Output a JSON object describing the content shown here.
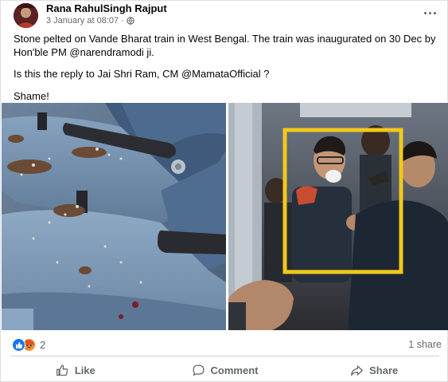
{
  "post": {
    "author": "Rana RahulSingh Rajput",
    "timestamp": "3 January at 08:07",
    "separator": "·",
    "privacy_icon": "globe-icon",
    "more_icon": "more-options-icon",
    "paragraphs": [
      "Stone pelted on Vande Bharat train in West Bengal. The train was inaugurated on 30 Dec by Hon'ble PM @narendramodi ji.",
      "Is this the reply to Jai Shri Ram, CM @MamataOfficial ?",
      "Shame!"
    ],
    "photos": [
      "damaged-train-seats-photo",
      "passengers-highlighted-photo"
    ],
    "highlight_color": "#f2c81a"
  },
  "stats": {
    "reaction_icons": [
      "like-reaction-icon",
      "angry-reaction-icon"
    ],
    "reaction_count": "2",
    "shares": "1 share"
  },
  "actions": {
    "like": "Like",
    "comment": "Comment",
    "share": "Share"
  },
  "colors": {
    "accent": "#1877f2",
    "secondary_text": "#65676b",
    "angry": "#f28b2a"
  }
}
